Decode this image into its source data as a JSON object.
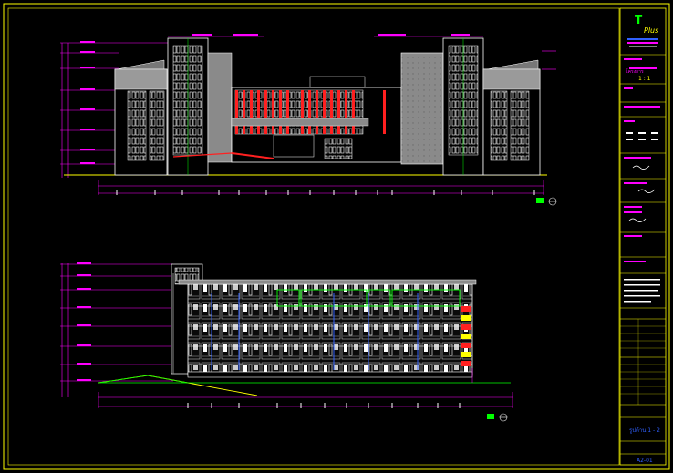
{
  "drawing": {
    "title_block": {
      "logo_text": "T",
      "logo_sub": "Plus",
      "project_label": "โครงการ",
      "scale_text": "มาตราส่วน",
      "scale_value": "1 : 1",
      "sheet_number": "A2-01",
      "section_label": "รูปด้าน 1 - 2"
    },
    "colors": {
      "background": "#000000",
      "frame": "#ffff00",
      "building_line": "#ffffff",
      "dimension": "#ff00ff",
      "ground_line": "#ffff00",
      "accent_red": "#ff2020",
      "accent_green": "#00ff00",
      "accent_blue": "#3060ff",
      "gray_panel": "#8a8a8a"
    }
  }
}
